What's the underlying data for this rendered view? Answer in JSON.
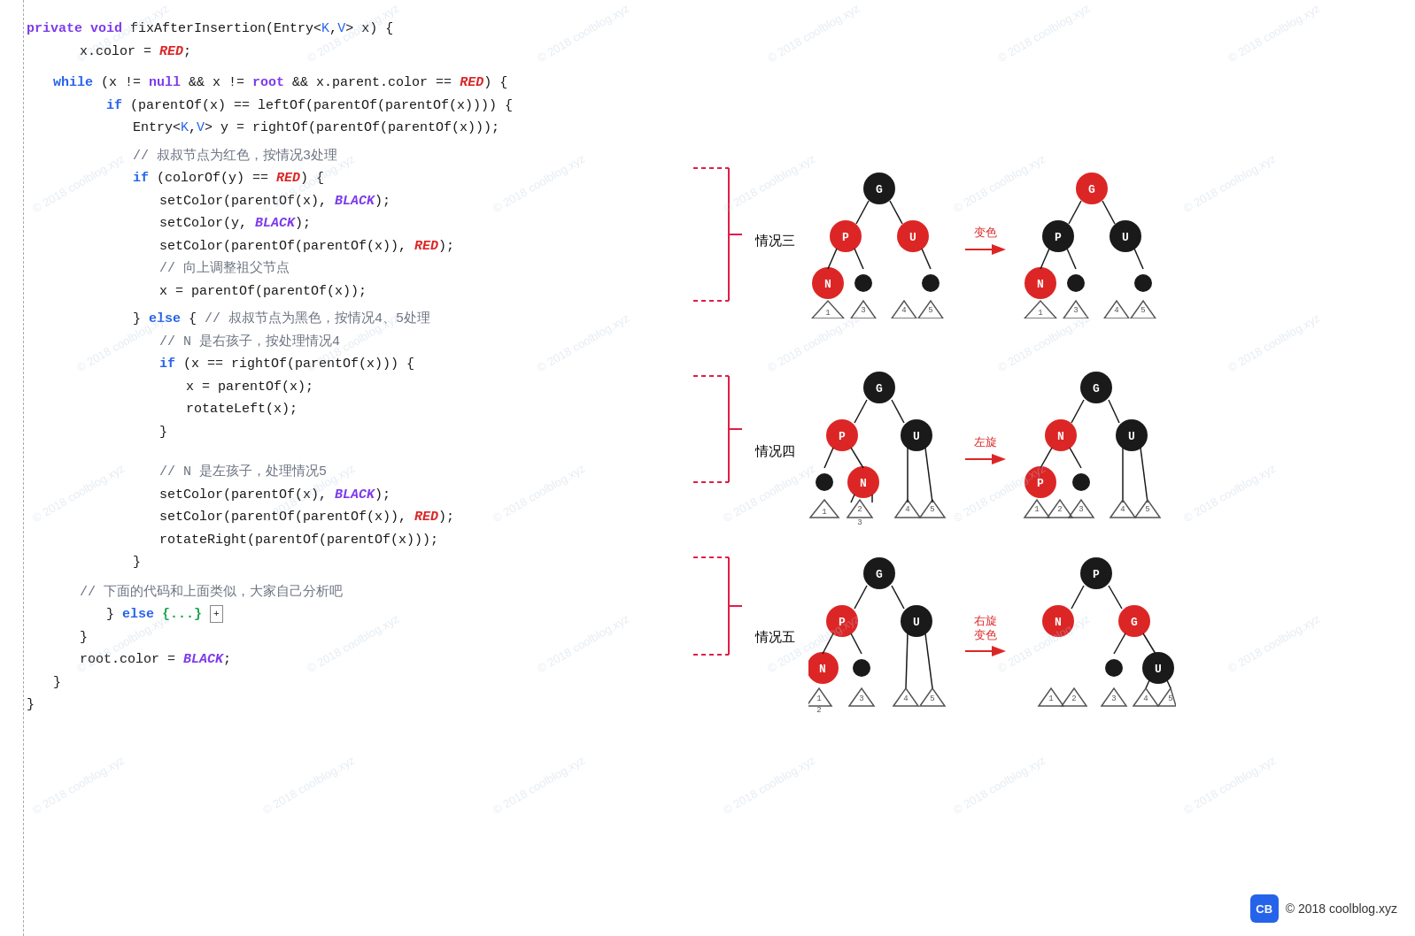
{
  "footer": {
    "logo": "CB",
    "copyright": "© 2018 coolblog.xyz"
  },
  "watermarks": [
    "© 2018 coolblog.xyz",
    "© 2018 coolblog.xyz",
    "© 2018 coolblog.xyz",
    "© 2018 coolblog.xyz",
    "© 2018 coolblog.xyz",
    "© 2018 coolblog.xyz",
    "© 2018 coolblog.xyz",
    "© 2018 coolblog.xyz",
    "© 2018 coolblog.xyz",
    "© 2018 coolblog.xyz",
    "© 2018 coolblog.xyz",
    "© 2018 coolblog.xyz"
  ],
  "situations": [
    {
      "label": "情况三",
      "arrow_label": "变色"
    },
    {
      "label": "情况四",
      "arrow_label": "左旋"
    },
    {
      "label": "情况五",
      "arrow_label": "右旋\n变色"
    }
  ]
}
